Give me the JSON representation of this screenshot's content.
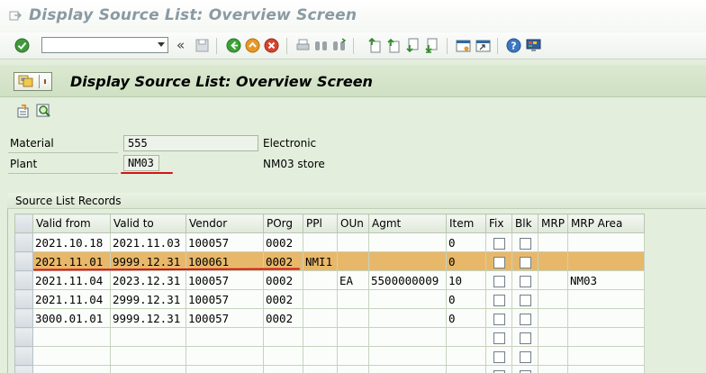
{
  "window_title": "Display Source List: Overview Screen",
  "screen_title": "Display Source List: Overview Screen",
  "toolbar": {
    "command_field_value": "",
    "icons": [
      "enter-check-icon",
      "history-back-icon",
      "save-icon",
      "back-icon",
      "exit-icon",
      "cancel-icon",
      "print-icon",
      "find-icon",
      "find-next-icon",
      "first-page-icon",
      "previous-page-icon",
      "next-page-icon",
      "last-page-icon",
      "create-session-icon",
      "create-shortcut-icon",
      "help-icon",
      "customize-layout-icon"
    ]
  },
  "fields": {
    "material": {
      "label": "Material",
      "value": "555",
      "description": "Electronic"
    },
    "plant": {
      "label": "Plant",
      "value": "NM03",
      "description": "NM03 store"
    }
  },
  "group_title": "Source List Records",
  "table": {
    "columns": [
      "Valid from",
      "Valid to",
      "Vendor",
      "POrg",
      "PPl",
      "OUn",
      "Agmt",
      "Item",
      "Fix",
      "Blk",
      "MRP",
      "MRP Area"
    ],
    "rows": [
      {
        "valid_from": "2021.10.18",
        "valid_to": "2021.11.03",
        "vendor": "100057",
        "porg": "0002",
        "ppl": "",
        "oun": "",
        "agmt": "",
        "item": "0",
        "fix": false,
        "blk": false,
        "mrp": "",
        "mrp_area": "",
        "highlight": false
      },
      {
        "valid_from": "2021.11.01",
        "valid_to": "9999.12.31",
        "vendor": "100061",
        "porg": "0002",
        "ppl": "NMI1",
        "oun": "",
        "agmt": "",
        "item": "0",
        "fix": false,
        "blk": false,
        "mrp": "",
        "mrp_area": "",
        "highlight": true
      },
      {
        "valid_from": "2021.11.04",
        "valid_to": "2023.12.31",
        "vendor": "100057",
        "porg": "0002",
        "ppl": "",
        "oun": "EA",
        "agmt": "5500000009",
        "item": "10",
        "fix": false,
        "blk": false,
        "mrp": "",
        "mrp_area": "NM03",
        "highlight": false
      },
      {
        "valid_from": "2021.11.04",
        "valid_to": "2999.12.31",
        "vendor": "100057",
        "porg": "0002",
        "ppl": "",
        "oun": "",
        "agmt": "",
        "item": "0",
        "fix": false,
        "blk": false,
        "mrp": "",
        "mrp_area": "",
        "highlight": false
      },
      {
        "valid_from": "3000.01.01",
        "valid_to": "9999.12.31",
        "vendor": "100057",
        "porg": "0002",
        "ppl": "",
        "oun": "",
        "agmt": "",
        "item": "0",
        "fix": false,
        "blk": false,
        "mrp": "",
        "mrp_area": "",
        "highlight": false
      },
      {
        "valid_from": "",
        "valid_to": "",
        "vendor": "",
        "porg": "",
        "ppl": "",
        "oun": "",
        "agmt": "",
        "item": "",
        "fix": false,
        "blk": false,
        "mrp": "",
        "mrp_area": "",
        "highlight": false
      },
      {
        "valid_from": "",
        "valid_to": "",
        "vendor": "",
        "porg": "",
        "ppl": "",
        "oun": "",
        "agmt": "",
        "item": "",
        "fix": false,
        "blk": false,
        "mrp": "",
        "mrp_area": "",
        "highlight": false
      },
      {
        "valid_from": "",
        "valid_to": "",
        "vendor": "",
        "porg": "",
        "ppl": "",
        "oun": "",
        "agmt": "",
        "item": "",
        "fix": false,
        "blk": false,
        "mrp": "",
        "mrp_area": "",
        "highlight": false
      }
    ]
  },
  "colors": {
    "highlight_row": "#e8b86a",
    "annotation_red": "#d2141a",
    "background": "#e3eedc"
  }
}
